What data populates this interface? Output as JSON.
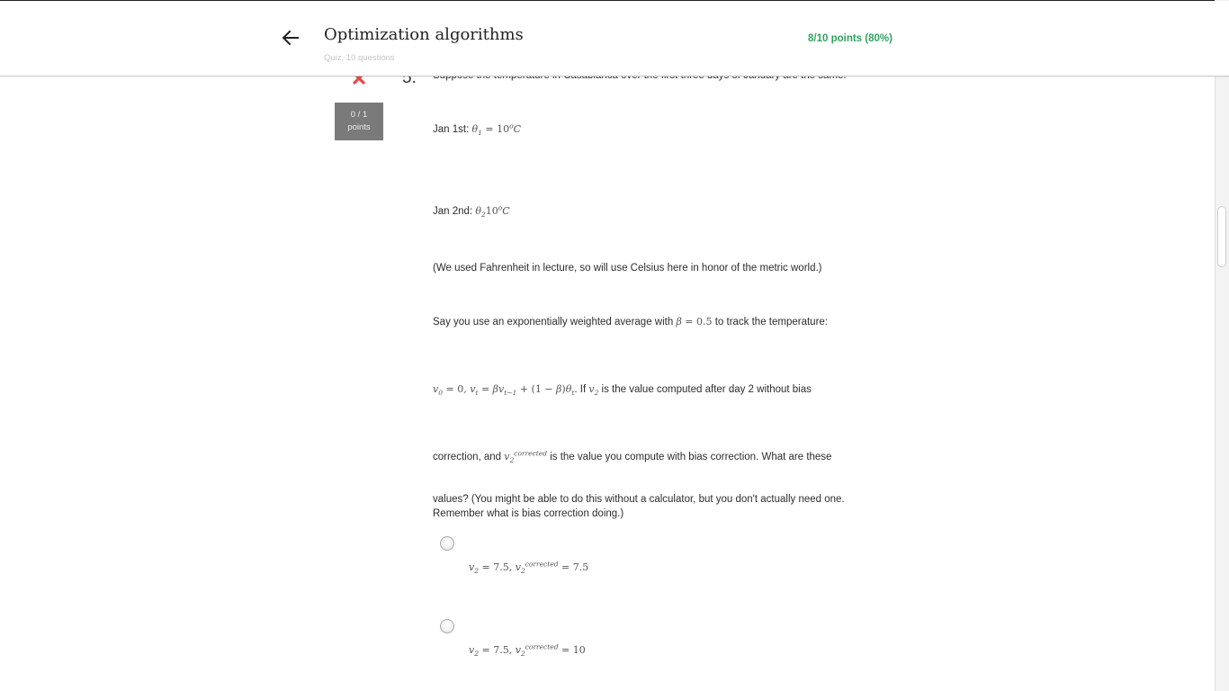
{
  "header": {
    "title": "Optimization algorithms",
    "subtitle": "Quiz, 10 questions",
    "score": "8/10 points (80%)"
  },
  "question": {
    "number": "5.",
    "points_line1": "0 / 1",
    "points_line2": "points",
    "intro": "Suppose the temperature in Casablanca over the first three days of January are the same:",
    "jan1_label": "Jan 1st: ",
    "jan2_label": "Jan 2nd: ",
    "note": "(We used Fahrenheit in lecture, so will use Celsius here in honor of the metric world.)",
    "ewa_pre": "Say you use an exponentially weighted average with ",
    "ewa_post": " to track the temperature:",
    "formula_mid": ". If ",
    "formula_post": " is the value computed after day 2 without bias",
    "correction_pre": "correction, and ",
    "correction_post": " is the value you compute with bias correction. What are these",
    "values_text": "values? (You might be able to do this without a calculator, but you don't actually need one. Remember what is bias correction doing.)"
  },
  "options": [
    {
      "v2": "7.5",
      "v2_corrected": "7.5"
    },
    {
      "v2": "7.5",
      "v2_corrected": "10"
    }
  ],
  "colors": {
    "score_green": "#2fa360",
    "badge_gray": "#7a7a7a",
    "wrong_red": "#e8474b"
  },
  "icons": {
    "back": "arrow-left-icon",
    "status": "close-x-icon"
  }
}
